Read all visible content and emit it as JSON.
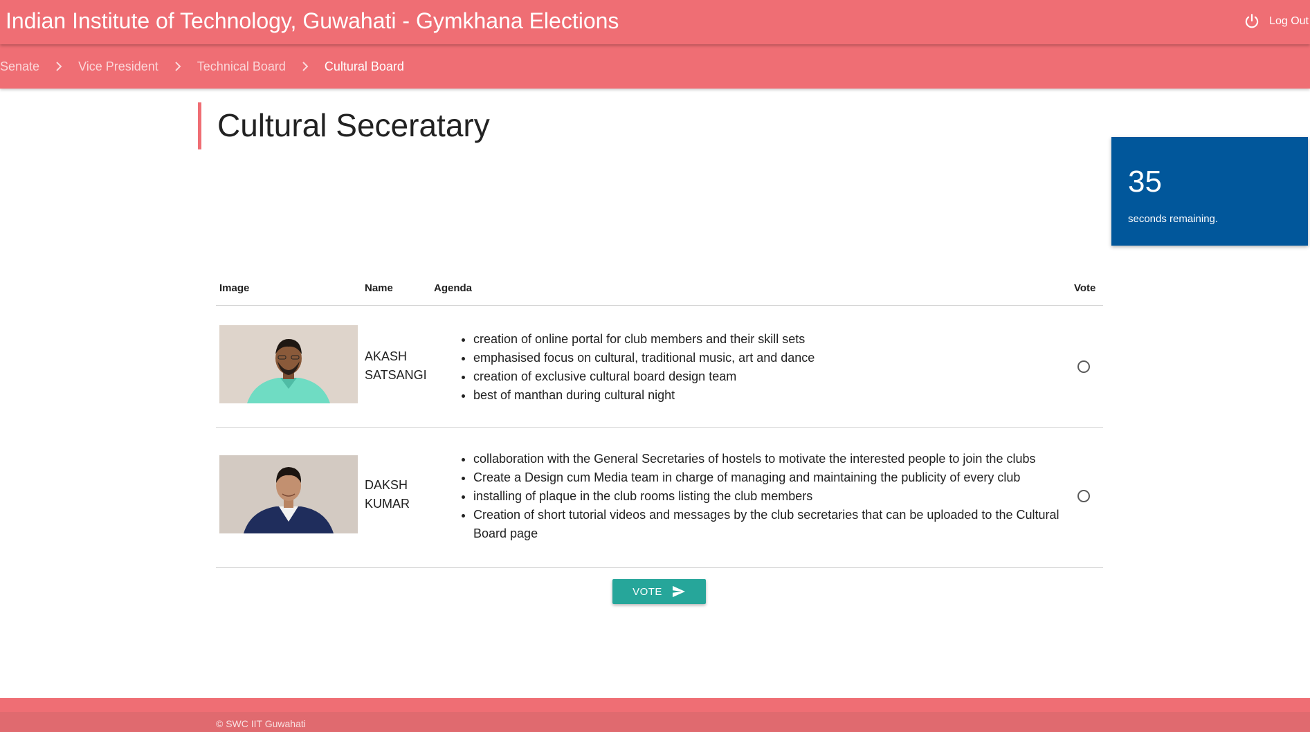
{
  "header": {
    "brand": "Indian Institute of Technology, Guwahati - Gymkhana Elections",
    "logout_label": "Log Out"
  },
  "breadcrumbs": [
    {
      "label": "Senate"
    },
    {
      "label": "Vice President"
    },
    {
      "label": "Technical Board"
    },
    {
      "label": "Cultural Board"
    }
  ],
  "page_title": "Cultural Seceratary",
  "timer": {
    "count": "35",
    "label": "seconds remaining."
  },
  "table": {
    "columns": [
      "Image",
      "Name",
      "Agenda",
      "Vote"
    ],
    "rows": [
      {
        "name_line1": "AKASH",
        "name_line2": "SATSANGI",
        "agenda": [
          "creation of online portal for club members and their skill sets",
          "emphasised focus on cultural, traditional music, art and dance",
          "creation of exclusive cultural board design team",
          "best of manthan during cultural night"
        ],
        "selected": false
      },
      {
        "name_line1": "DAKSH",
        "name_line2": "KUMAR",
        "agenda": [
          "collaboration with the General Secretaries of hostels to motivate the interested people to join the clubs",
          "Create a Design cum Media team in charge of managing and maintaining the publicity of every club",
          "installing of plaque in the club rooms listing the club members",
          "Creation of short tutorial videos and messages by the club secretaries that can be uploaded to the Cultural Board page"
        ],
        "selected": false
      }
    ]
  },
  "vote_button": {
    "label": "VOTE"
  },
  "footer": {
    "copyright": "© SWC IIT Guwahati"
  },
  "colors": {
    "brand": "#ef6e74",
    "timer": "#01579b",
    "button": "#26a69a"
  }
}
